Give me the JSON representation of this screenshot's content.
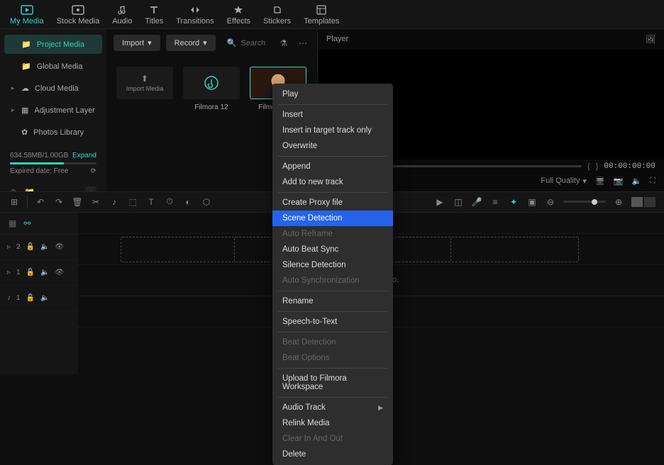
{
  "tabs": [
    {
      "label": "My Media",
      "icon": "media"
    },
    {
      "label": "Stock Media",
      "icon": "stock"
    },
    {
      "label": "Audio",
      "icon": "audio"
    },
    {
      "label": "Titles",
      "icon": "titles"
    },
    {
      "label": "Transitions",
      "icon": "transitions"
    },
    {
      "label": "Effects",
      "icon": "effects"
    },
    {
      "label": "Stickers",
      "icon": "stickers"
    },
    {
      "label": "Templates",
      "icon": "templates"
    }
  ],
  "sidebar": {
    "items": [
      {
        "label": "Project Media",
        "icon": "folder",
        "active": true
      },
      {
        "label": "Global Media",
        "icon": "folder"
      },
      {
        "label": "Cloud Media",
        "icon": "cloud",
        "expandable": true
      },
      {
        "label": "Adjustment Layer",
        "icon": "layer",
        "expandable": true
      },
      {
        "label": "Photos Library",
        "icon": "photos"
      }
    ],
    "storage": {
      "used": "634.58MB/1.00GB",
      "expand": "Expand",
      "expired": "Expired date: Free",
      "percent": 62
    }
  },
  "toolbar": {
    "import": "Import",
    "record": "Record",
    "search_placeholder": "Search"
  },
  "media": {
    "import_label": "Import Media",
    "items": [
      {
        "label": "Filmora 12",
        "type": "placeholder"
      },
      {
        "label": "Filmora Tu...",
        "type": "video",
        "selected": true
      }
    ]
  },
  "player": {
    "title": "Player",
    "time": "00:00:00:00",
    "quality": "Full Quality"
  },
  "timeline": {
    "drop_text": "eate your video.",
    "tracks": [
      {
        "label": "2",
        "type": "video"
      },
      {
        "label": "1",
        "type": "video"
      },
      {
        "label": "1",
        "type": "audio"
      }
    ]
  },
  "context_menu": [
    {
      "label": "Play"
    },
    {
      "sep": true
    },
    {
      "label": "Insert"
    },
    {
      "label": "Insert in target track only"
    },
    {
      "label": "Overwrite"
    },
    {
      "sep": true
    },
    {
      "label": "Append"
    },
    {
      "label": "Add to new track"
    },
    {
      "sep": true
    },
    {
      "label": "Create Proxy file"
    },
    {
      "label": "Scene Detection",
      "highlight": true
    },
    {
      "label": "Auto Reframe",
      "disabled": true
    },
    {
      "label": "Auto Beat Sync"
    },
    {
      "label": "Silence Detection"
    },
    {
      "label": "Auto Synchronization",
      "disabled": true
    },
    {
      "sep": true
    },
    {
      "label": "Rename"
    },
    {
      "sep": true
    },
    {
      "label": "Speech-to-Text"
    },
    {
      "sep": true
    },
    {
      "label": "Beat Detection",
      "disabled": true
    },
    {
      "label": "Beat Options",
      "disabled": true
    },
    {
      "sep": true
    },
    {
      "label": "Upload to Filmora Workspace"
    },
    {
      "sep": true
    },
    {
      "label": "Audio Track",
      "submenu": true
    },
    {
      "label": "Relink Media"
    },
    {
      "label": "Clear In And Out",
      "disabled": true
    },
    {
      "label": "Delete"
    }
  ]
}
